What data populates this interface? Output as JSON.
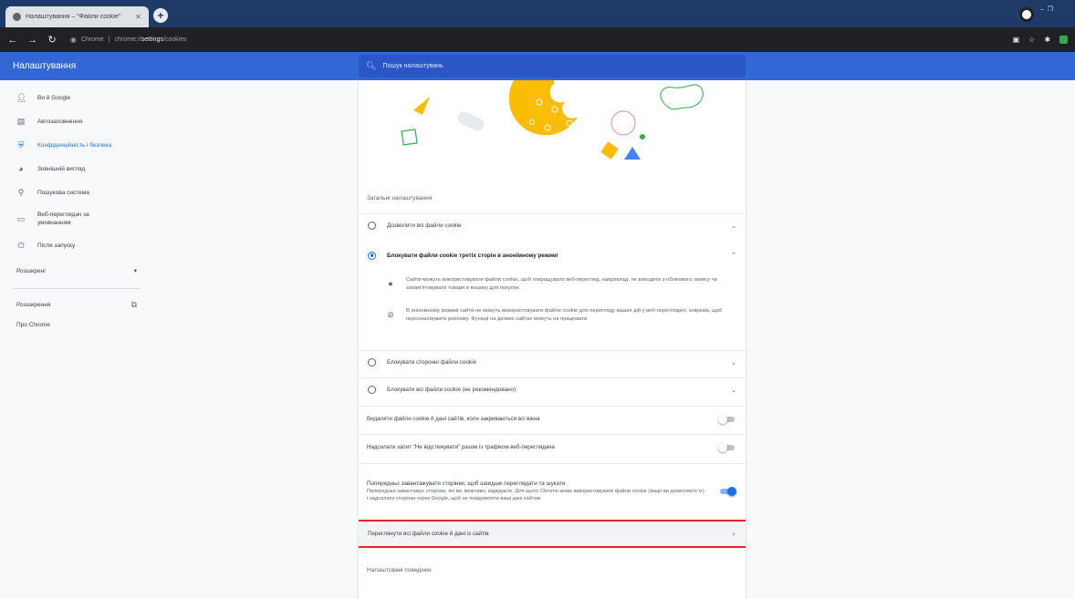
{
  "browser": {
    "tab_title": "Налаштування – \"Файли cookie\"",
    "tab_close": "✕",
    "new_tab": "+",
    "url_chip": "Chrome",
    "url_sep": "|",
    "url_prefix": "chrome://",
    "url_bold": "settings",
    "url_suffix": "/cookies",
    "window_controls": "– ❐"
  },
  "header": {
    "title": "Налаштування",
    "search_placeholder": "Пошук налаштувань"
  },
  "sidebar": {
    "items": [
      {
        "label": "Ви й Google",
        "icon": "person-icon"
      },
      {
        "label": "Автозаповнення",
        "icon": "clipboard-icon"
      },
      {
        "label": "Конфіденційність і безпека",
        "icon": "shield-icon"
      },
      {
        "label": "Зовнішній вигляд",
        "icon": "palette-icon"
      },
      {
        "label": "Пошукова система",
        "icon": "search-icon"
      },
      {
        "label": "Веб-переглядач за умовчанням",
        "icon": "browser-icon"
      },
      {
        "label": "Після запуску",
        "icon": "power-icon"
      }
    ],
    "advanced": "Розширені",
    "extensions": "Розширення",
    "about": "Про Chrome"
  },
  "main": {
    "general_label": "Загальні налаштування",
    "options": [
      {
        "label": "Дозволити всі файли cookie",
        "checked": false
      },
      {
        "label": "Блокувати файли cookie третіх сторін в анонімному режимі",
        "checked": true
      },
      {
        "label": "Блокувати сторонні файли cookie",
        "checked": false
      },
      {
        "label": "Блокувати всі файли cookie (не рекомендовано)",
        "checked": false
      }
    ],
    "details": [
      "Сайти можуть використовувати файли cookie, щоб покращувати веб-перегляд, наприклад, не виходити з облікового запису чи запам'ятовувати товари в кошику для покупок",
      "В анонімному режимі сайти не можуть використовувати файли cookie для перегляду ваших дій у веб-переглядачі, зокрема, щоб персоналізувати рекламу. Функції на деяких сайтах можуть не працювати"
    ],
    "toggle_clear": "Видаляти файли cookie й дані сайтів, коли закриваються всі вікна",
    "toggle_dnt": "Надсилати запит \"Не відстежувати\" разом із трафіком веб-переглядача",
    "preload_title": "Попередньо завантажувати сторінки, щоб швидше переглядати та шукати",
    "preload_desc": "Попередньо завантажує сторінки, які ви, можливо, відвідаєте. Для цього Chrome може використовувати файли cookie (якщо ви дозволяєте їх) і надсилати сторінки через Google, щоб не повідомляти ваші дані сайтам",
    "see_all": "Переглянути всі файли cookie й дані із сайтів",
    "custom_label": "Налаштовані поведінки"
  },
  "colors": {
    "header": "#3367d6",
    "accent": "#1a73e8",
    "highlight": "#e0262b"
  }
}
